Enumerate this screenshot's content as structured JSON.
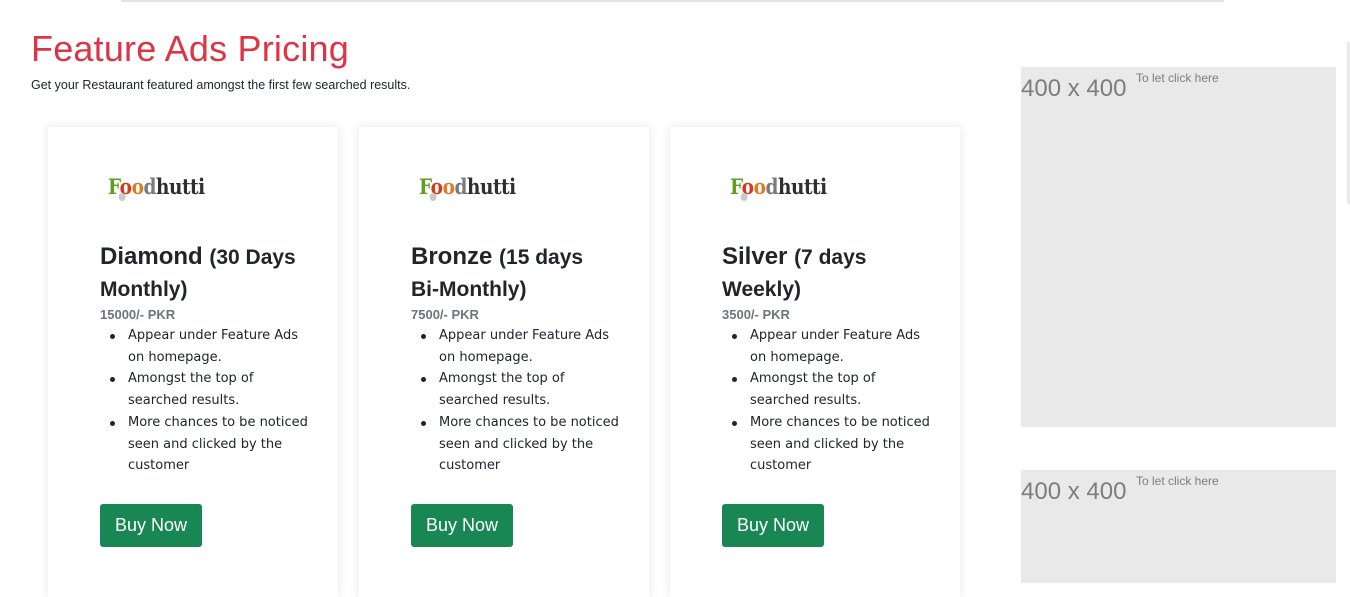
{
  "header": {
    "title": "Feature Ads Pricing",
    "subtitle": "Get your Restaurant featured amongst the first few searched results."
  },
  "brand": {
    "logo_text": "Foodhutti",
    "logo_parts": [
      "F",
      "o",
      "o",
      "d",
      "hutti"
    ],
    "colors": {
      "f": "#5f9e1d",
      "o1": "#d33a1e",
      "o2": "#e07a20",
      "rest": "#2f2f2f"
    }
  },
  "plans": [
    {
      "name": "Diamond",
      "duration": "(30 Days Monthly)",
      "price": "15000/- PKR",
      "features": [
        "Appear under Feature Ads on homepage.",
        "Amongst the top of searched results.",
        "More chances to be noticed seen and clicked by the customer"
      ],
      "button_label": "Buy Now"
    },
    {
      "name": "Bronze",
      "duration": "(15 days Bi-Monthly)",
      "price": "7500/- PKR",
      "features": [
        "Appear under Feature Ads on homepage.",
        "Amongst the top of searched results.",
        "More chances to be noticed seen and clicked by the customer"
      ],
      "button_label": "Buy Now"
    },
    {
      "name": "Silver",
      "duration": "(7 days Weekly)",
      "price": "3500/- PKR",
      "features": [
        "Appear under Feature Ads on homepage.",
        "Amongst the top of searched results.",
        "More chances to be noticed seen and clicked by the customer"
      ],
      "button_label": "Buy Now"
    }
  ],
  "ads": [
    {
      "size_label": "400 x 400",
      "cta": "To let click here"
    },
    {
      "size_label": "400 x 400",
      "cta": "To let click here"
    }
  ],
  "colors": {
    "title": "#dc3545",
    "button": "#198754",
    "ad_placeholder": "#e9e9e9"
  }
}
